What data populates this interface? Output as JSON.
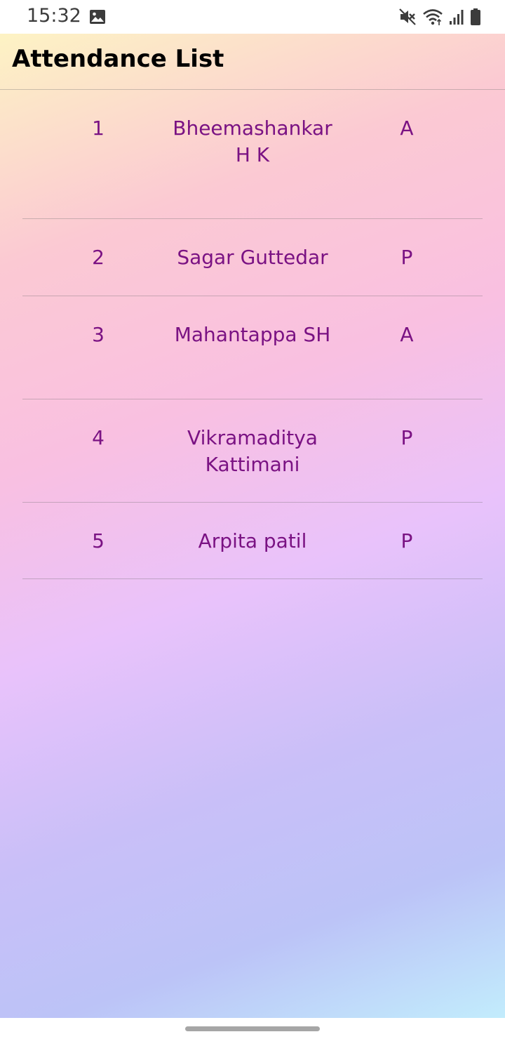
{
  "status_bar": {
    "time": "15:32",
    "icons": [
      "gallery-icon",
      "mute-icon",
      "wifi-icon",
      "signal-icon",
      "battery-icon"
    ]
  },
  "app_bar": {
    "title": "Attendance List"
  },
  "attendance": [
    {
      "number": "1",
      "name": "Bheemashankar H K",
      "status": "A"
    },
    {
      "number": "2",
      "name": "Sagar Guttedar",
      "status": "P"
    },
    {
      "number": "3",
      "name": "Mahantappa SH",
      "status": "A"
    },
    {
      "number": "4",
      "name": "Vikramaditya Kattimani",
      "status": "P"
    },
    {
      "number": "5",
      "name": "Arpita patil",
      "status": "P"
    }
  ],
  "colors": {
    "row_text": "#7a1283",
    "title_text": "#000000",
    "gradient_start": "#fdf3c4",
    "gradient_end": "#c2ecfc"
  }
}
